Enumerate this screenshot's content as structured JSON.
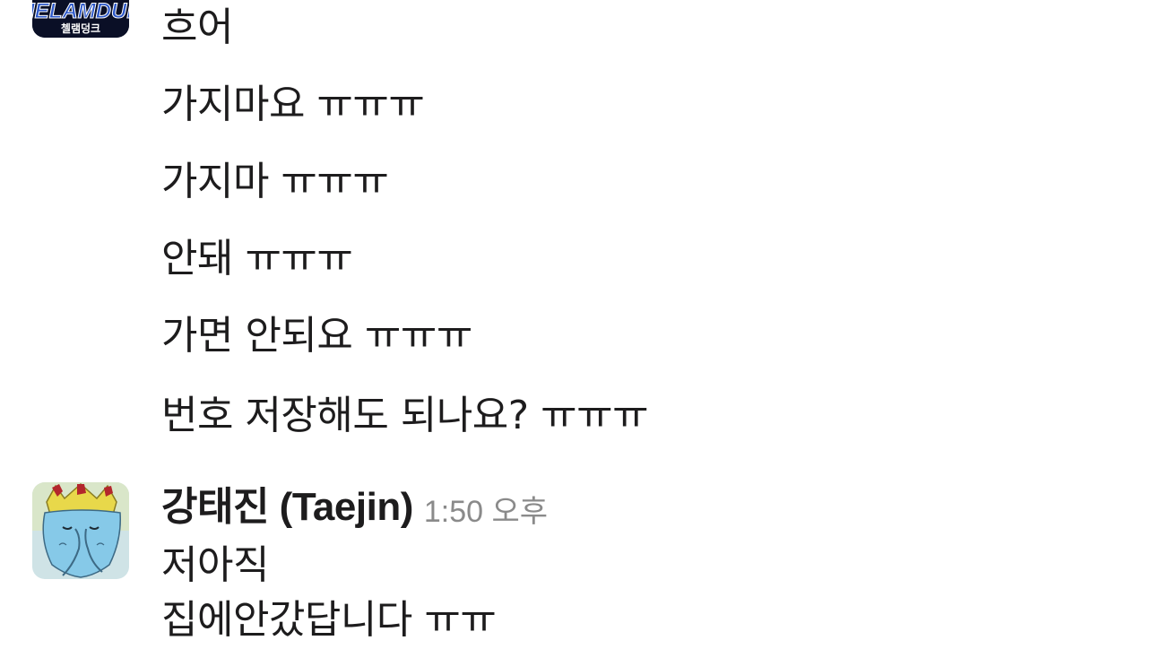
{
  "messages_group_1": {
    "avatar_text_top": "CHELAMDUNK",
    "avatar_text_bottom": "첼램덩크",
    "lines": [
      "흐어",
      "가지마요 ㅠㅠㅠ",
      "가지마 ㅠㅠㅠ",
      "안돼 ㅠㅠㅠ",
      "가면 안되요 ㅠㅠㅠ",
      "번호 저장해도 되나요? ㅠㅠㅠ"
    ]
  },
  "messages_group_2": {
    "sender": "강태진 (Taejin)",
    "timestamp": "1:50 오후",
    "lines": [
      "저아직",
      "집에안갔답니다 ㅠㅠ"
    ]
  }
}
